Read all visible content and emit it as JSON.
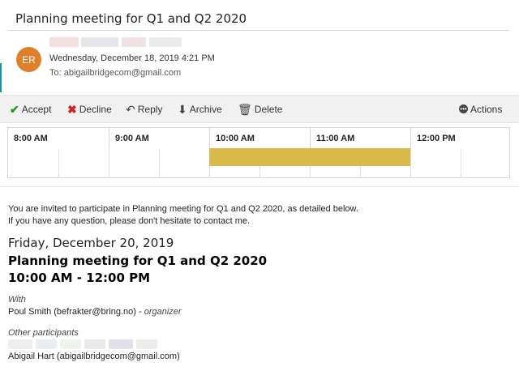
{
  "email": {
    "subject": "Planning meeting for Q1 and Q2 2020",
    "sender_initials": "ER",
    "sent": "Wednesday, December 18, 2019 4:21 PM",
    "to": "To: abigailbridgecom@gmail.com"
  },
  "toolbar": {
    "accept": "Accept",
    "decline": "Decline",
    "reply": "Reply",
    "archive": "Archive",
    "delete": "Delete",
    "actions": "Actions"
  },
  "calendar": {
    "hours": [
      "8:00 AM",
      "9:00 AM",
      "10:00 AM",
      "11:00 AM",
      "12:00 PM"
    ],
    "busy_start": "10:00 AM",
    "busy_end": "12:00 PM",
    "busy_color": "#d8bb4a"
  },
  "body": {
    "invite_line1": "You are invited to participate in Planning meeting for Q1 and Q2 2020, as detailed below.",
    "invite_line2": "If you have any question, please don't hesitate to contact me.",
    "date": "Friday, December 20, 2019",
    "meeting_title": "Planning meeting for Q1 and Q2 2020",
    "time": "10:00 AM - 12:00 PM",
    "with_label": "With",
    "organizer_name": "Poul Smith (befrakter@bring.no)",
    "organizer_role": "organizer",
    "other_label": "Other participants",
    "participant": "Abigail Hart (abigailbridgecom@gmail.com)"
  },
  "colors": {
    "accept": "#1e9a2a",
    "decline": "#d42020",
    "avatar": "#e07f2a"
  }
}
